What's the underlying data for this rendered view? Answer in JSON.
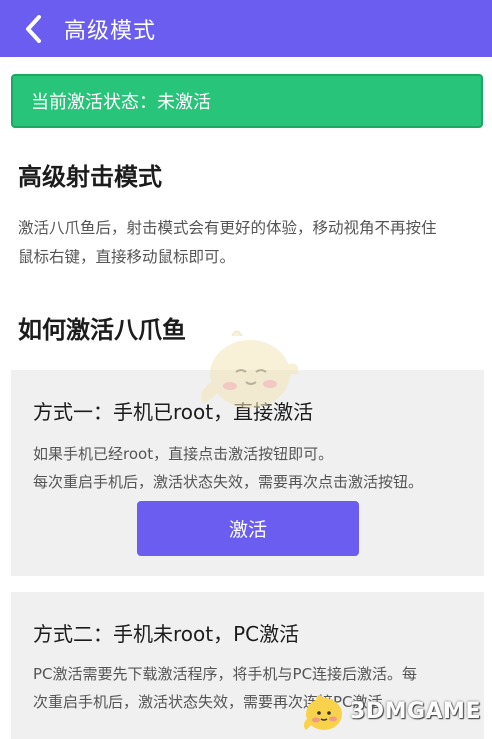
{
  "header": {
    "title": "高级模式",
    "back_icon": "chevron-left-icon"
  },
  "status": {
    "text": "当前激活状态：未激活",
    "color": "#27c47a"
  },
  "section_mode": {
    "heading": "高级射击模式",
    "lines": [
      "激活八爪鱼后，射击模式会有更好的体验，移动视角不再按住",
      "鼠标右键，直接移动鼠标即可。"
    ]
  },
  "section_howto": {
    "heading": "如何激活八爪鱼"
  },
  "method1": {
    "title": "方式一：手机已root，直接激活",
    "lines": [
      "如果手机已经root，直接点击激活按钮即可。",
      "每次重启手机后，激活状态失效，需要再次点击激活按钮。"
    ],
    "button_label": "激活"
  },
  "method2": {
    "title": "方式二：手机未root，PC激活",
    "lines": [
      "PC激活需要先下载激活程序，将手机与PC连接后激活。每",
      "次重启手机后，激活状态失效，需要再次连接PC激活"
    ]
  },
  "watermark": {
    "text": "3DMGAME"
  },
  "colors": {
    "accent": "#6a5df0",
    "card_bg": "#f0f0f0"
  }
}
